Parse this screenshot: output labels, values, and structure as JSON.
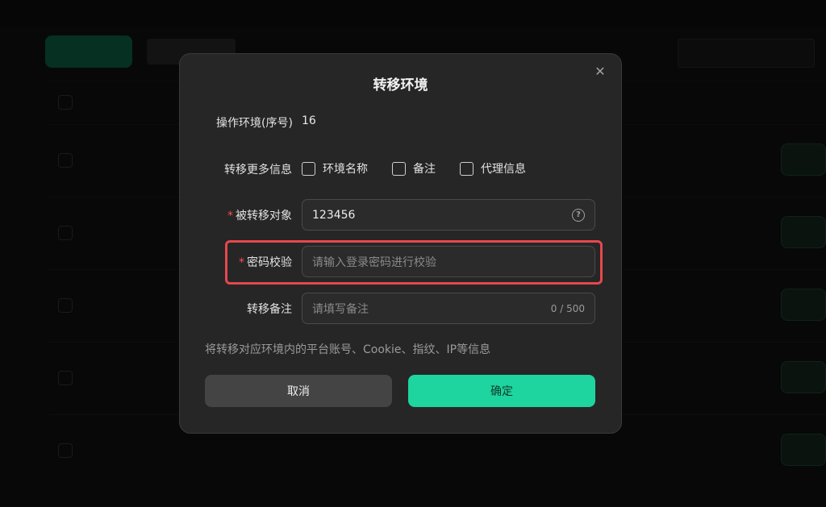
{
  "dialog": {
    "title": "转移环境",
    "close_label": "✕",
    "env_label": "操作环境(序号)",
    "env_value": "16",
    "more_info_label": "转移更多信息",
    "checkboxes": [
      {
        "label": "环境名称",
        "checked": false
      },
      {
        "label": "备注",
        "checked": false
      },
      {
        "label": "代理信息",
        "checked": false
      }
    ],
    "target": {
      "label": "被转移对象",
      "required": "*",
      "value": "123456",
      "help_icon": "question-circle-icon"
    },
    "password": {
      "label": "密码校验",
      "required": "*",
      "placeholder": "请输入登录密码进行校验"
    },
    "remark": {
      "label": "转移备注",
      "placeholder": "请填写备注",
      "counter": "0 / 500"
    },
    "note": "将转移对应环境内的平台账号、Cookie、指纹、IP等信息",
    "cancel_label": "取消",
    "confirm_label": "确定"
  },
  "colors": {
    "accent": "#1ed49f",
    "highlight": "#e5484d",
    "required": "#ff4d4f"
  }
}
